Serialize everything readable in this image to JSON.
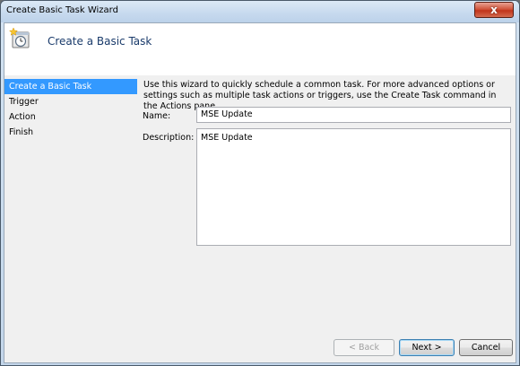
{
  "window": {
    "title": "Create Basic Task Wizard",
    "close_glyph": "x"
  },
  "header": {
    "title": "Create a Basic Task",
    "icon": "scheduled-task-clock-icon"
  },
  "nav": {
    "items": [
      {
        "label": "Create a Basic Task",
        "active": true
      },
      {
        "label": "Trigger",
        "active": false
      },
      {
        "label": "Action",
        "active": false
      },
      {
        "label": "Finish",
        "active": false
      }
    ]
  },
  "main": {
    "description": "Use this wizard to quickly schedule a common task.  For more advanced options or settings such as multiple task actions or triggers, use the Create Task command in the Actions pane.",
    "name_label": "Name:",
    "name_value": "MSE Update",
    "description_label": "Description:",
    "description_value": "MSE Update"
  },
  "buttons": {
    "back": "< Back",
    "next": "Next >",
    "cancel": "Cancel"
  },
  "colors": {
    "selection": "#3399ff",
    "header_text": "#1a3b6b"
  }
}
